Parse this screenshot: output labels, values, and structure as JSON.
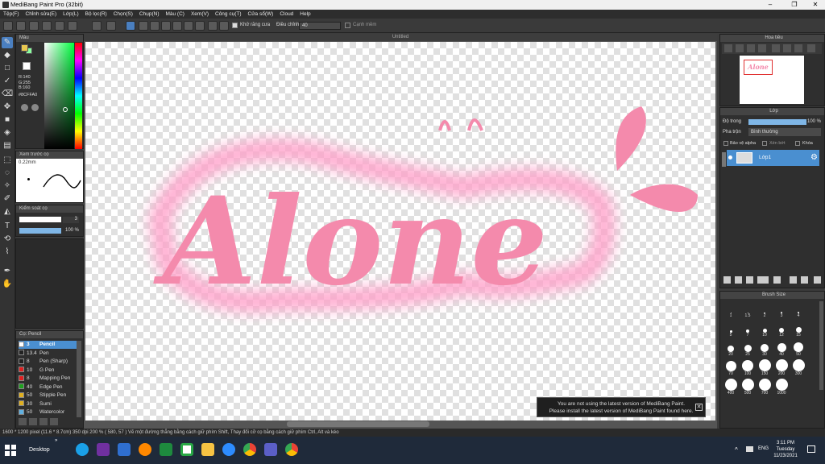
{
  "window": {
    "title": "MediBang Paint Pro (32bit)"
  },
  "menu": [
    "Tệp(F)",
    "Chỉnh sửa(E)",
    "Lớp(L)",
    "Bộ lọc(R)",
    "Chọn(S)",
    "Chụp(N)",
    "Màu (C)",
    "Xem(V)",
    "Công cụ(T)",
    "Cửa sổ(W)",
    "Cloud",
    "Help"
  ],
  "toolbar": {
    "antialias_label": "Khử răng cưa",
    "adjust_label": "Điều chỉnh",
    "adjust_value": "40",
    "smooth_label": "Cạnh mềm"
  },
  "color_panel": {
    "title": "Màu",
    "r": "R:140",
    "g": "G:255",
    "b": "B:160",
    "hex": "#8CFFA0"
  },
  "brush_preview": {
    "title": "Xem trước cọ",
    "size": "0.22mm"
  },
  "brush_control": {
    "title": "Kiểm soát cọ",
    "size": "3",
    "opacity": "100 %"
  },
  "brush_list": {
    "title": "Cọ: Pencil",
    "items": [
      {
        "num": "3",
        "name": "Pencil",
        "color": "#ffffff"
      },
      {
        "num": "13.4",
        "name": "Pen",
        "color": "#222222"
      },
      {
        "num": "8",
        "name": "Pen (Sharp)",
        "color": "#222222"
      },
      {
        "num": "10",
        "name": "G Pen",
        "color": "#e02020"
      },
      {
        "num": "8",
        "name": "Mapping Pen",
        "color": "#e02020"
      },
      {
        "num": "40",
        "name": "Edge Pen",
        "color": "#1fa01f"
      },
      {
        "num": "50",
        "name": "Stipple Pen",
        "color": "#e0b020"
      },
      {
        "num": "30",
        "name": "Sumi",
        "color": "#e0b020"
      },
      {
        "num": "50",
        "name": "Watercolor",
        "color": "#60b0e0"
      }
    ]
  },
  "canvas": {
    "doc_title": "Untitled",
    "artwork_text": "Alone"
  },
  "navigator": {
    "title": "Hoa tiêu"
  },
  "layers": {
    "title": "Lớp",
    "opacity_label": "Độ trong",
    "opacity_value": "100 %",
    "blend_label": "Pha trộn",
    "blend_value": "Bình thường",
    "protect_alpha": "Bảo vệ alpha",
    "clipping": "Xén bớt",
    "lock": "Khóa",
    "layer_name": "Lớp1"
  },
  "brush_size": {
    "title": "Brush Size",
    "sizes": [
      "1",
      "1.5",
      "2",
      "3",
      "4",
      "5",
      "7",
      "10",
      "12",
      "15",
      "20",
      "25",
      "30",
      "40",
      "50",
      "70",
      "100",
      "150",
      "200",
      "300",
      "400",
      "500",
      "700",
      "1000"
    ]
  },
  "notification": {
    "line1": "You are not using the latest version of MediBang Paint.",
    "line2": "Please install the latest version of MediBang Paint found here."
  },
  "status": {
    "text": "1600 * 1200 pixel   (11.6 * 8.7cm)   350 dpi   200 %   ( 580, 57 )   Vẽ một đường thẳng bằng cách giữ phím Shift, Thay đổi cỡ cọ bằng cách giữ phím Ctrl, Alt và kéo"
  },
  "taskbar": {
    "desktop": "Desktop",
    "lang": "ENG",
    "time": "3:11 PM",
    "day": "Tuesday",
    "date": "11/23/2021"
  }
}
